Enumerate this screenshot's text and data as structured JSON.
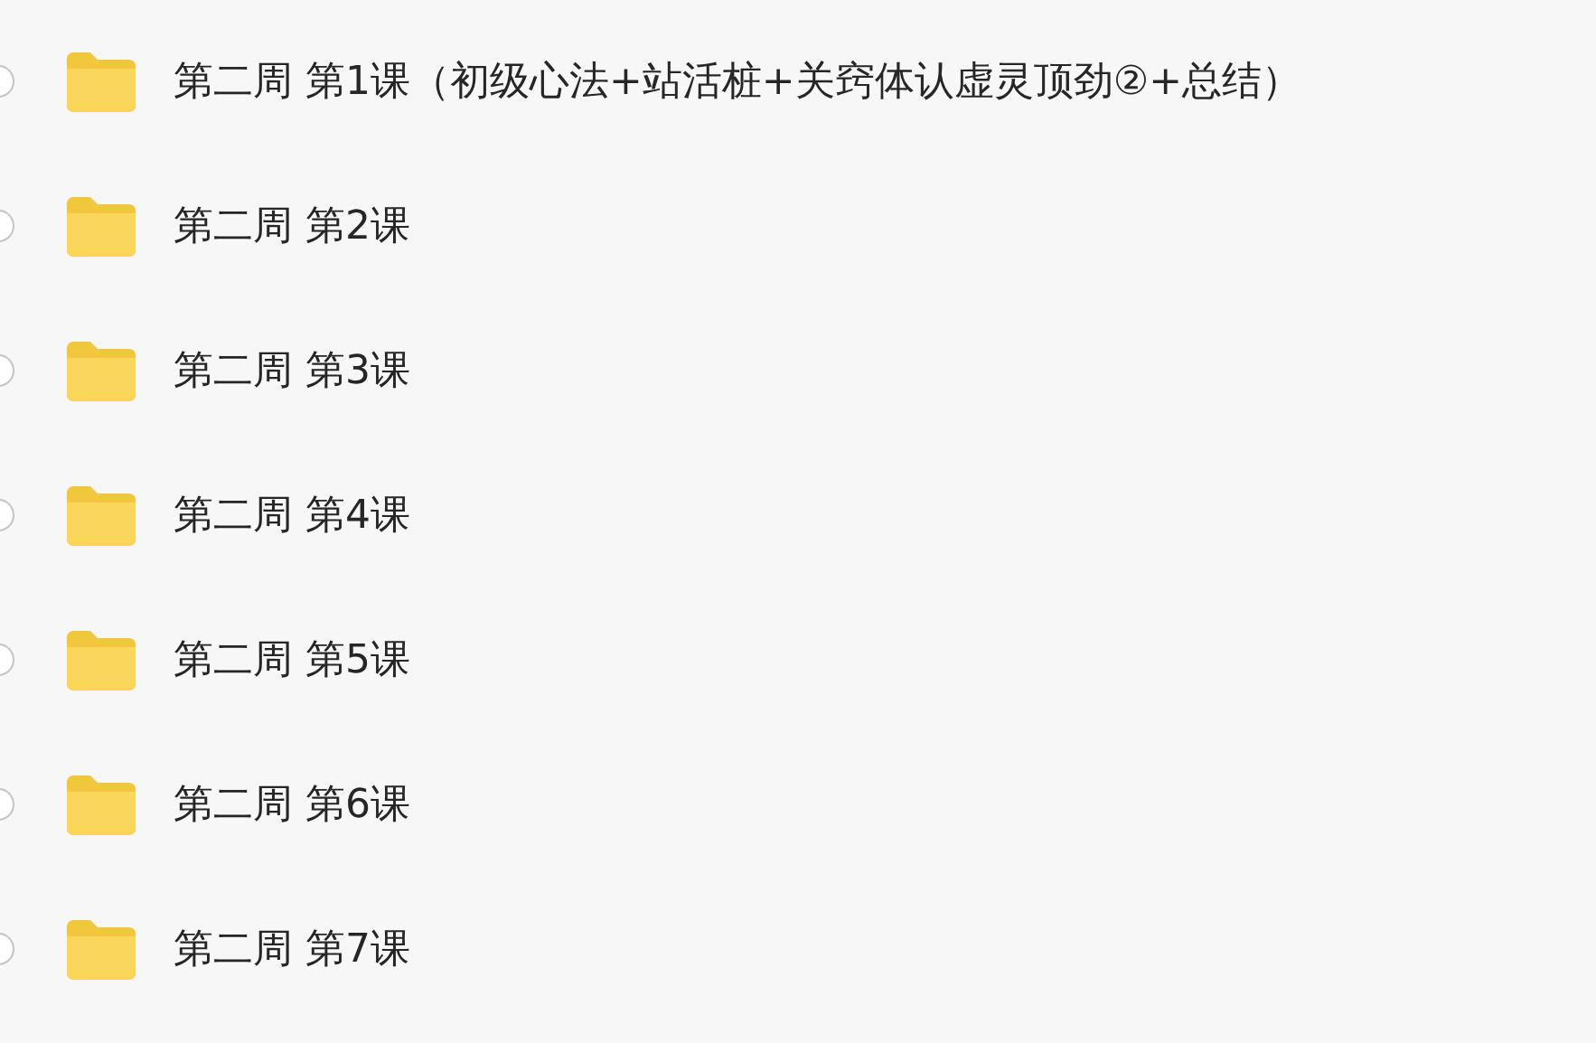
{
  "folders": [
    {
      "name": "第二周 第1课（初级心法+站活桩+关窍体认虚灵顶劲②+总结）",
      "checked": false
    },
    {
      "name": "第二周 第2课",
      "checked": false
    },
    {
      "name": "第二周 第3课",
      "checked": false
    },
    {
      "name": "第二周 第4课",
      "checked": false
    },
    {
      "name": "第二周 第5课",
      "checked": false
    },
    {
      "name": "第二周 第6课",
      "checked": false
    },
    {
      "name": "第二周 第7课",
      "checked": false
    }
  ]
}
